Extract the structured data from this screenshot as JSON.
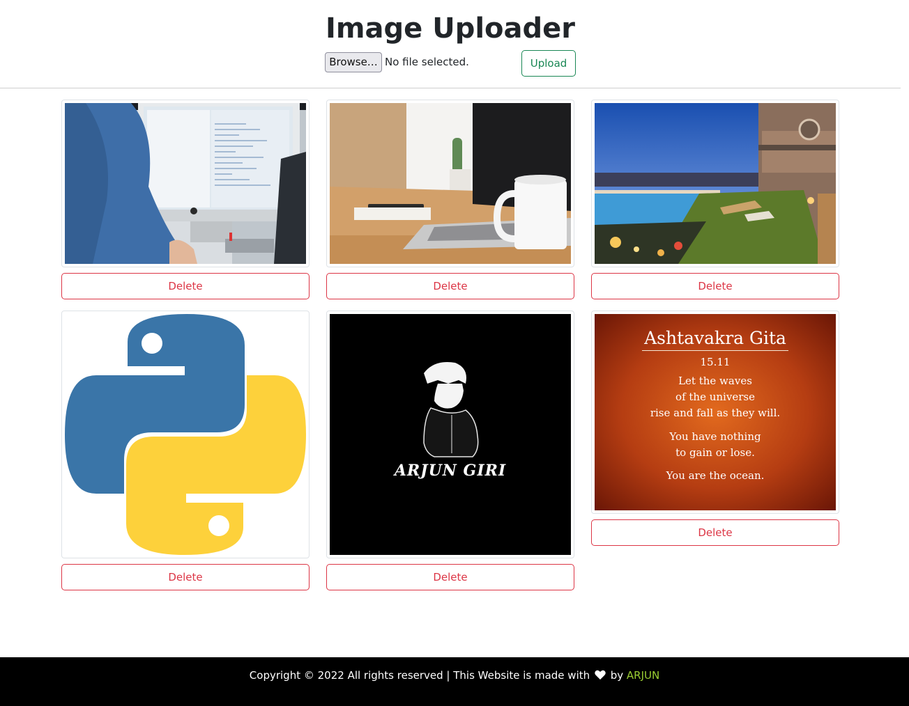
{
  "header": {
    "title": "Image Uploader",
    "browse_label": "Browse…",
    "file_status": "No file selected.",
    "upload_label": "Upload"
  },
  "gallery": {
    "items": [
      {
        "image": "desktop-computer-coding-photo",
        "delete_label": "Delete"
      },
      {
        "image": "laptop-and-mug-desk-photo",
        "delete_label": "Delete"
      },
      {
        "image": "rooftop-pool-evening-photo",
        "delete_label": "Delete"
      },
      {
        "image": "python-logo",
        "delete_label": "Delete"
      },
      {
        "image": "arjun-giri-avatar-logo",
        "caption": "ARJUN GIRI",
        "delete_label": "Delete"
      },
      {
        "image": "ashtavakra-gita-quote",
        "quote_title": "Ashtavakra Gita",
        "quote_verse": "15.11",
        "quote_line1": "Let the waves",
        "quote_line2": "of the universe",
        "quote_line3": "rise and fall as they will.",
        "quote_line4": "You have nothing",
        "quote_line5": "to gain or lose.",
        "quote_line6": "You are the ocean.",
        "delete_label": "Delete"
      }
    ]
  },
  "footer": {
    "text_before": "Copyright © 2022 All rights reserved | This Website is made with",
    "heart_icon": "heart-icon",
    "by": "by",
    "author": "ARJUN"
  },
  "colors": {
    "success": "#198754",
    "danger": "#dc3545",
    "author": "#9acd32",
    "footer_bg": "#000000"
  }
}
